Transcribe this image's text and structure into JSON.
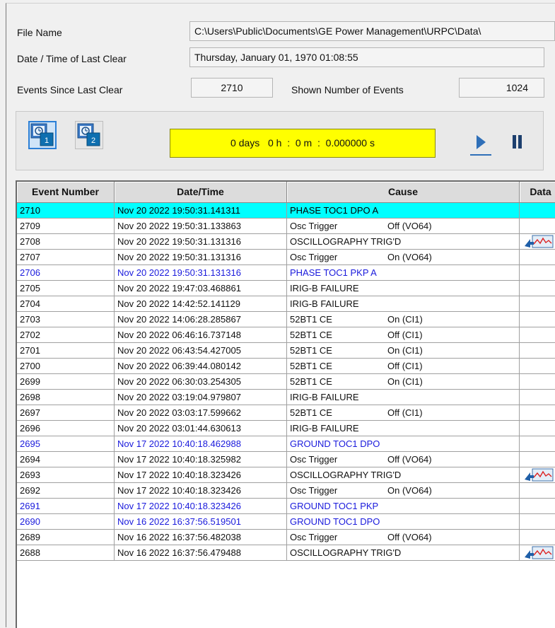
{
  "header": {
    "file_name_label": "File Name",
    "file_name_value": "C:\\Users\\Public\\Documents\\GE Power Management\\URPC\\Data\\",
    "last_clear_label": "Date / Time of Last Clear",
    "last_clear_value": "Thursday, January 01, 1970 01:08:55",
    "events_since_label": "Events Since Last Clear",
    "events_since_value": "2710",
    "shown_events_label": "Shown Number of Events",
    "shown_events_value": "1024"
  },
  "controls": {
    "timer_text": "0 days   0 h  :  0 m  :  0.000000 s",
    "icons": [
      "clock-marker-1-icon",
      "clock-marker-2-icon",
      "play-icon",
      "pause-icon"
    ]
  },
  "table": {
    "columns": [
      "Event Number",
      "Date/Time",
      "Cause",
      "Data"
    ],
    "rows": [
      {
        "num": "2710",
        "dt": "Nov 20 2022 19:50:31.141311",
        "cause": "PHASE TOC1 DPO A",
        "state": "",
        "style": "selected",
        "data": false
      },
      {
        "num": "2709",
        "dt": "Nov 20 2022 19:50:31.133863",
        "cause": "Osc Trigger",
        "state": "Off (VO64)",
        "style": "black",
        "data": false
      },
      {
        "num": "2708",
        "dt": "Nov 20 2022 19:50:31.131316",
        "cause": "OSCILLOGRAPHY TRIG'D",
        "state": "",
        "style": "black",
        "data": true
      },
      {
        "num": "2707",
        "dt": "Nov 20 2022 19:50:31.131316",
        "cause": "Osc Trigger",
        "state": "On (VO64)",
        "style": "black",
        "data": false
      },
      {
        "num": "2706",
        "dt": "Nov 20 2022 19:50:31.131316",
        "cause": "PHASE TOC1 PKP A",
        "state": "",
        "style": "blue",
        "data": false
      },
      {
        "num": "2705",
        "dt": "Nov 20 2022 19:47:03.468861",
        "cause": "IRIG-B FAILURE",
        "state": "",
        "style": "black",
        "data": false
      },
      {
        "num": "2704",
        "dt": "Nov 20 2022 14:42:52.141129",
        "cause": "IRIG-B FAILURE",
        "state": "",
        "style": "black",
        "data": false
      },
      {
        "num": "2703",
        "dt": "Nov 20 2022 14:06:28.285867",
        "cause": "52BT1 CE",
        "state": "On (CI1)",
        "style": "black",
        "data": false
      },
      {
        "num": "2702",
        "dt": "Nov 20 2022 06:46:16.737148",
        "cause": "52BT1 CE",
        "state": "Off (CI1)",
        "style": "black",
        "data": false
      },
      {
        "num": "2701",
        "dt": "Nov 20 2022 06:43:54.427005",
        "cause": "52BT1 CE",
        "state": "On (CI1)",
        "style": "black",
        "data": false
      },
      {
        "num": "2700",
        "dt": "Nov 20 2022 06:39:44.080142",
        "cause": "52BT1 CE",
        "state": "Off (CI1)",
        "style": "black",
        "data": false
      },
      {
        "num": "2699",
        "dt": "Nov 20 2022 06:30:03.254305",
        "cause": "52BT1 CE",
        "state": "On (CI1)",
        "style": "black",
        "data": false
      },
      {
        "num": "2698",
        "dt": "Nov 20 2022 03:19:04.979807",
        "cause": "IRIG-B FAILURE",
        "state": "",
        "style": "black",
        "data": false
      },
      {
        "num": "2697",
        "dt": "Nov 20 2022 03:03:17.599662",
        "cause": "52BT1 CE",
        "state": "Off (CI1)",
        "style": "black",
        "data": false
      },
      {
        "num": "2696",
        "dt": "Nov 20 2022 03:01:44.630613",
        "cause": "IRIG-B FAILURE",
        "state": "",
        "style": "black",
        "data": false
      },
      {
        "num": "2695",
        "dt": "Nov 17 2022 10:40:18.462988",
        "cause": "GROUND TOC1 DPO",
        "state": "",
        "style": "blue",
        "data": false
      },
      {
        "num": "2694",
        "dt": "Nov 17 2022 10:40:18.325982",
        "cause": "Osc Trigger",
        "state": "Off (VO64)",
        "style": "black",
        "data": false
      },
      {
        "num": "2693",
        "dt": "Nov 17 2022 10:40:18.323426",
        "cause": "OSCILLOGRAPHY TRIG'D",
        "state": "",
        "style": "black",
        "data": true
      },
      {
        "num": "2692",
        "dt": "Nov 17 2022 10:40:18.323426",
        "cause": "Osc Trigger",
        "state": "On (VO64)",
        "style": "black",
        "data": false
      },
      {
        "num": "2691",
        "dt": "Nov 17 2022 10:40:18.323426",
        "cause": "GROUND TOC1 PKP",
        "state": "",
        "style": "blue",
        "data": false
      },
      {
        "num": "2690",
        "dt": "Nov 16 2022 16:37:56.519501",
        "cause": "GROUND TOC1 DPO",
        "state": "",
        "style": "blue",
        "data": false
      },
      {
        "num": "2689",
        "dt": "Nov 16 2022 16:37:56.482038",
        "cause": "Osc Trigger",
        "state": "Off (VO64)",
        "style": "black",
        "data": false
      },
      {
        "num": "2688",
        "dt": "Nov 16 2022 16:37:56.479488",
        "cause": "OSCILLOGRAPHY TRIG'D",
        "state": "",
        "style": "black",
        "data": true
      }
    ]
  }
}
